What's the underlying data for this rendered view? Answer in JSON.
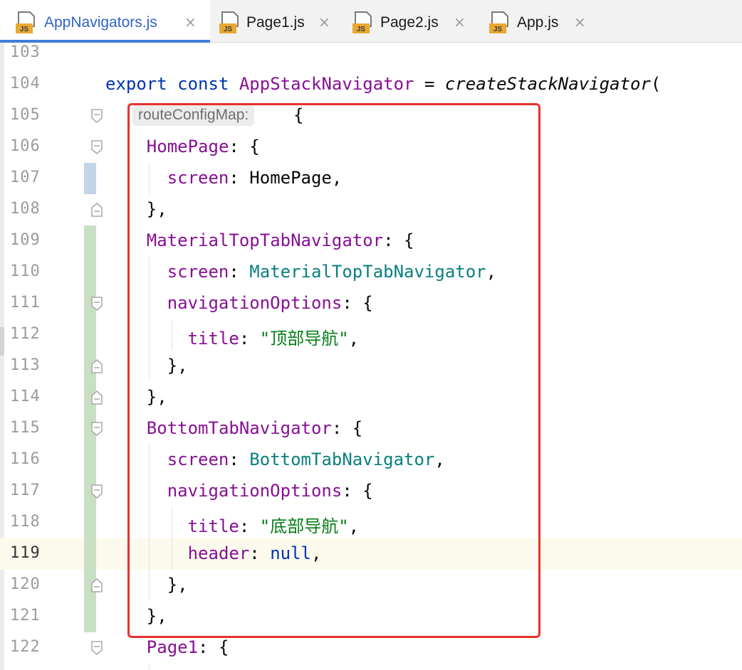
{
  "tabs": [
    {
      "name": "AppNavigators.js",
      "active": true,
      "icon": "js-file-icon"
    },
    {
      "name": "Page1.js",
      "active": false,
      "icon": "js-file-icon"
    },
    {
      "name": "Page2.js",
      "active": false,
      "icon": "js-file-icon"
    },
    {
      "name": "App.js",
      "active": false,
      "icon": "js-file-icon"
    }
  ],
  "tab_close_glyph": "×",
  "file_icon_text": "JS",
  "current_line": "119",
  "editor": {
    "lines": [
      {
        "num": "103"
      },
      {
        "num": "104",
        "tokens": [
          {
            "t": "export",
            "k": "kw"
          },
          {
            "t": " "
          },
          {
            "t": "const",
            "k": "kw"
          },
          {
            "t": " "
          },
          {
            "t": "AppStackNavigator",
            "k": "prop"
          },
          {
            "t": " = "
          },
          {
            "t": "createStackNavigator",
            "k": "fn"
          },
          {
            "t": "("
          }
        ]
      },
      {
        "num": "105",
        "hint": "routeConfigMap:",
        "tokens": [
          {
            "t": "{"
          }
        ]
      },
      {
        "num": "106",
        "tokens": [
          {
            "t": "HomePage",
            "k": "prop"
          },
          {
            "t": ": {"
          }
        ]
      },
      {
        "num": "107",
        "tokens": [
          {
            "t": "screen",
            "k": "prop"
          },
          {
            "t": ": HomePage,"
          }
        ]
      },
      {
        "num": "108",
        "tokens": [
          {
            "t": "},"
          }
        ]
      },
      {
        "num": "109",
        "tokens": [
          {
            "t": "MaterialTopTabNavigator",
            "k": "prop"
          },
          {
            "t": ": {"
          }
        ]
      },
      {
        "num": "110",
        "tokens": [
          {
            "t": "screen",
            "k": "prop"
          },
          {
            "t": ": "
          },
          {
            "t": "MaterialTopTabNavigator",
            "k": "cls"
          },
          {
            "t": ","
          }
        ]
      },
      {
        "num": "111",
        "tokens": [
          {
            "t": "navigationOptions",
            "k": "prop"
          },
          {
            "t": ": {"
          }
        ]
      },
      {
        "num": "112",
        "tokens": [
          {
            "t": "title",
            "k": "prop"
          },
          {
            "t": ": "
          },
          {
            "t": "\"顶部导航\"",
            "k": "str"
          },
          {
            "t": ","
          }
        ]
      },
      {
        "num": "113",
        "tokens": [
          {
            "t": "},"
          }
        ]
      },
      {
        "num": "114",
        "tokens": [
          {
            "t": "},"
          }
        ]
      },
      {
        "num": "115",
        "tokens": [
          {
            "t": "BottomTabNavigator",
            "k": "prop"
          },
          {
            "t": ": {"
          }
        ]
      },
      {
        "num": "116",
        "tokens": [
          {
            "t": "screen",
            "k": "prop"
          },
          {
            "t": ": "
          },
          {
            "t": "BottomTabNavigator",
            "k": "cls"
          },
          {
            "t": ","
          }
        ]
      },
      {
        "num": "117",
        "tokens": [
          {
            "t": "navigationOptions",
            "k": "prop"
          },
          {
            "t": ": {"
          }
        ]
      },
      {
        "num": "118",
        "tokens": [
          {
            "t": "title",
            "k": "prop"
          },
          {
            "t": ": "
          },
          {
            "t": "\"底部导航\"",
            "k": "str"
          },
          {
            "t": ","
          }
        ]
      },
      {
        "num": "119",
        "tokens": [
          {
            "t": "header",
            "k": "prop"
          },
          {
            "t": ": "
          },
          {
            "t": "null",
            "k": "kw"
          },
          {
            "t": ","
          }
        ]
      },
      {
        "num": "120",
        "tokens": [
          {
            "t": "},"
          }
        ]
      },
      {
        "num": "121",
        "tokens": [
          {
            "t": "},"
          }
        ]
      },
      {
        "num": "122",
        "tokens": [
          {
            "t": "Page1",
            "k": "prop"
          },
          {
            "t": ": {"
          }
        ]
      }
    ]
  },
  "colors": {
    "keyword": "#0033b3",
    "property": "#871094",
    "class_ref": "#0a7f7f",
    "string": "#067d17",
    "highlight_box": "#e8322e",
    "active_tab_accent": "#3f7fd6",
    "current_line_bg": "#fcfaed",
    "vcs_changed": "#c9dfc3",
    "vcs_modified": "#c3d4e6"
  }
}
